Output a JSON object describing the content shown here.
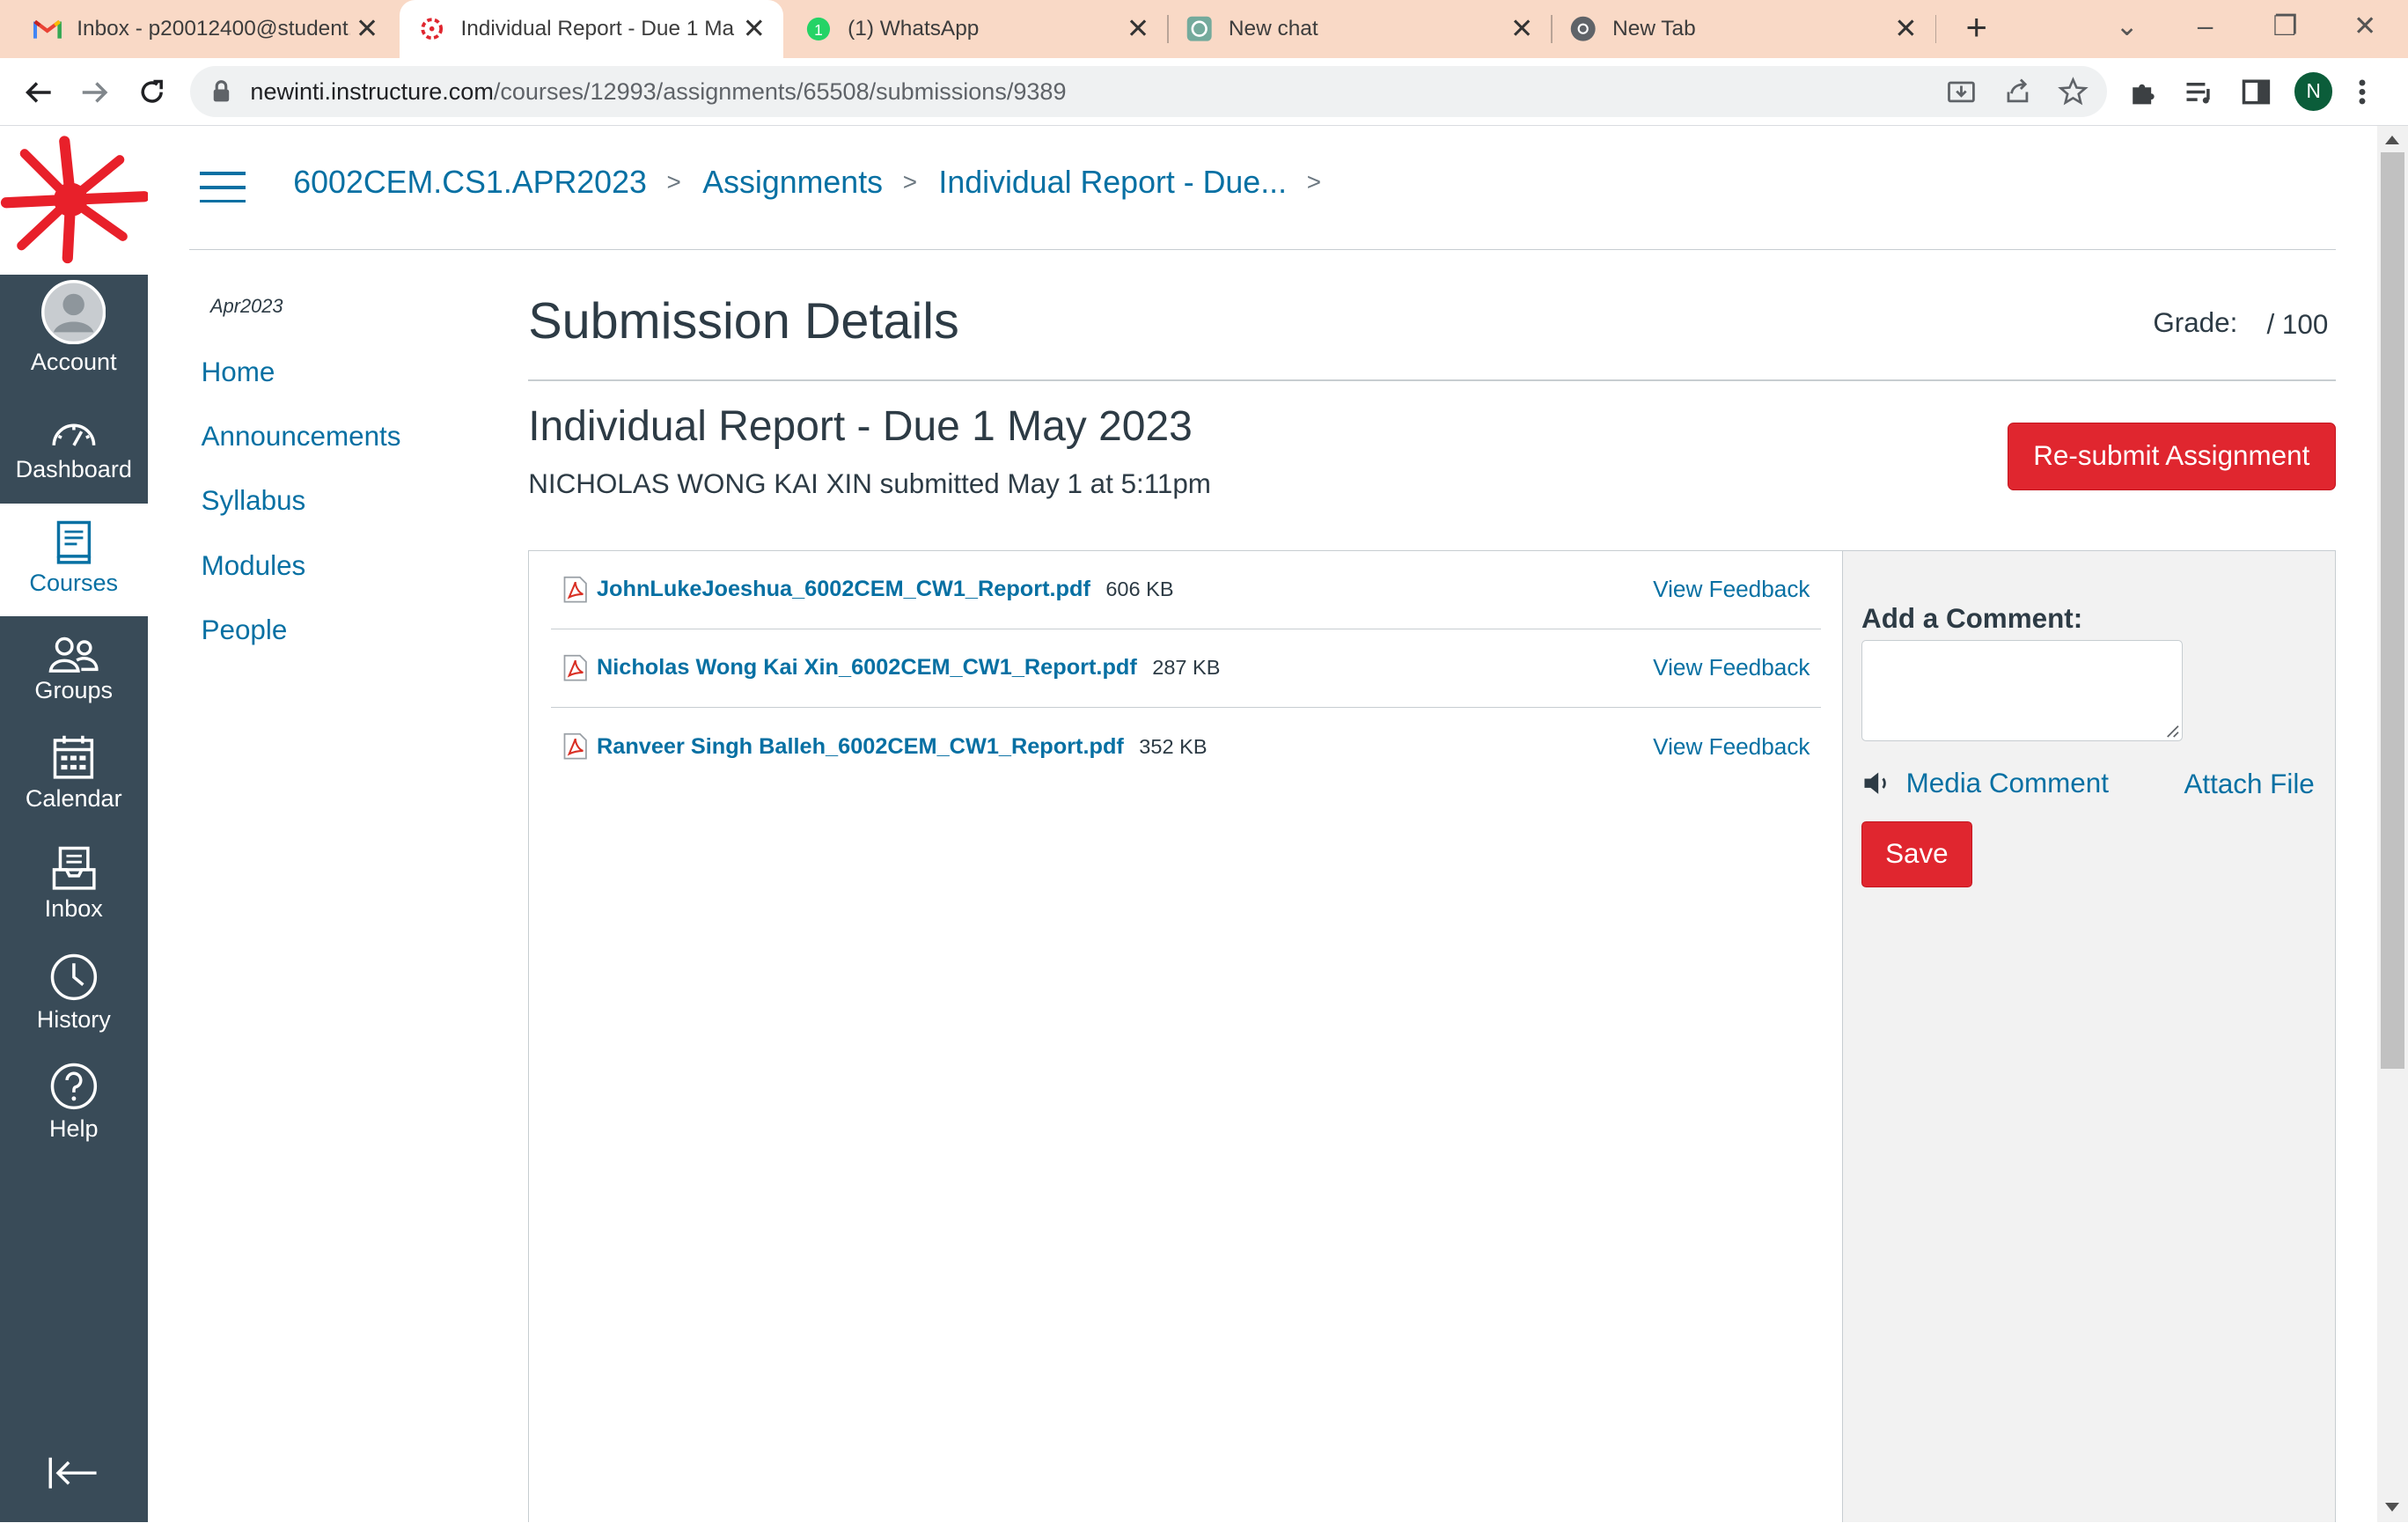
{
  "browser": {
    "tabs": [
      {
        "title": "Inbox - p20012400@student.",
        "icon": "gmail-icon",
        "active": false
      },
      {
        "title": "Individual Report - Due 1 Ma",
        "icon": "canvas-icon",
        "active": true
      },
      {
        "title": "(1) WhatsApp",
        "icon": "whatsapp-icon",
        "active": false
      },
      {
        "title": "New chat",
        "icon": "chatgpt-icon",
        "active": false
      },
      {
        "title": "New Tab",
        "icon": "chrome-icon",
        "active": false
      }
    ],
    "url_host": "newinti.instructure.com",
    "url_path": "/courses/12993/assignments/65508/submissions/9389",
    "profile_initial": "N",
    "tab_bar_color": "#f9d9c6"
  },
  "global_nav": {
    "items": [
      {
        "label": "Account",
        "icon": "avatar-icon"
      },
      {
        "label": "Dashboard",
        "icon": "dashboard-icon"
      },
      {
        "label": "Courses",
        "icon": "courses-icon",
        "active": true
      },
      {
        "label": "Groups",
        "icon": "groups-icon"
      },
      {
        "label": "Calendar",
        "icon": "calendar-icon"
      },
      {
        "label": "Inbox",
        "icon": "inbox-icon"
      },
      {
        "label": "History",
        "icon": "history-icon"
      },
      {
        "label": "Help",
        "icon": "help-icon"
      }
    ],
    "background": "#394b58",
    "accent": "#0770a3"
  },
  "breadcrumbs": [
    "6002CEM.CS1.APR2023",
    "Assignments",
    "Individual Report - Due..."
  ],
  "course_nav": {
    "term": "Apr2023",
    "links": [
      "Home",
      "Announcements",
      "Syllabus",
      "Modules",
      "People"
    ]
  },
  "submission": {
    "page_title": "Submission Details",
    "grade_label": "Grade:",
    "grade_value": "/ 100",
    "assignment_title": "Individual Report - Due 1 May 2023",
    "submitted_by": "NICHOLAS WONG KAI XIN submitted May 1 at 5:11pm",
    "resubmit_label": "Re-submit Assignment",
    "files": [
      {
        "name": "JohnLukeJoeshua_6002CEM_CW1_Report.pdf",
        "size": "606 KB",
        "action": "View Feedback"
      },
      {
        "name": "Nicholas Wong Kai Xin_6002CEM_CW1_Report.pdf",
        "size": "287 KB",
        "action": "View Feedback"
      },
      {
        "name": "Ranveer Singh Balleh_6002CEM_CW1_Report.pdf",
        "size": "352 KB",
        "action": "View Feedback"
      }
    ],
    "comment": {
      "label": "Add a Comment:",
      "value": "",
      "media_comment": "Media Comment",
      "attach_file": "Attach File",
      "save_label": "Save"
    },
    "button_color": "#e0262f"
  }
}
